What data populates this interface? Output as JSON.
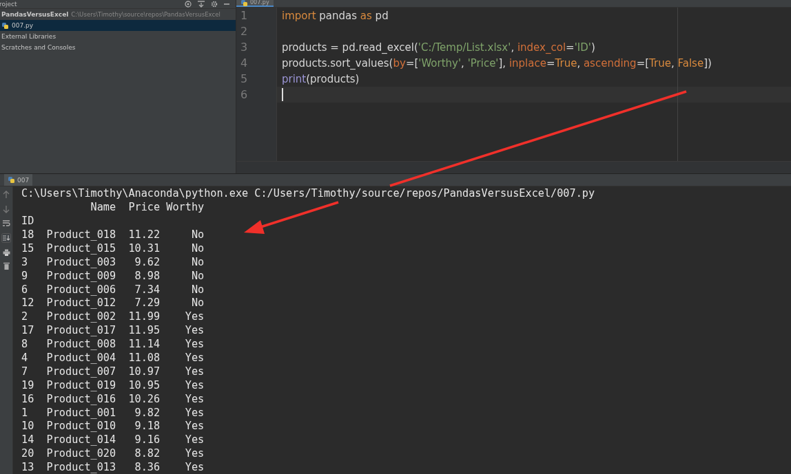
{
  "project_panel": {
    "title": "roject",
    "tree": [
      {
        "label": "PandasVersusExcel",
        "path": "C:\\Users\\Timothy\\source\\repos\\PandasVersusExcel",
        "kind": "folder",
        "selected": false,
        "children": [
          {
            "label": "007.py",
            "kind": "pyfile",
            "selected": true
          }
        ]
      },
      {
        "label": "External Libraries",
        "kind": "plain",
        "selected": false
      },
      {
        "label": "Scratches and Consoles",
        "kind": "plain",
        "selected": false
      }
    ]
  },
  "editor": {
    "tabs": [
      {
        "label": "007.py",
        "selected": true
      }
    ],
    "lines": [
      {
        "number": "1",
        "current": false,
        "tokens": [
          {
            "kind": "keyword",
            "text": "import"
          },
          {
            "kind": "plain",
            "text": " pandas "
          },
          {
            "kind": "keyword",
            "text": "as"
          },
          {
            "kind": "plain",
            "text": " pd"
          }
        ]
      },
      {
        "number": "2",
        "current": false
      },
      {
        "number": "3",
        "current": false,
        "tokens": [
          {
            "kind": "plain",
            "text": "products = pd.read_excel("
          },
          {
            "kind": "string",
            "text": "'C:/Temp/List.xlsx'"
          },
          {
            "kind": "plain",
            "text": ", "
          },
          {
            "kind": "param",
            "text": "index_col"
          },
          {
            "kind": "plain",
            "text": "="
          },
          {
            "kind": "string",
            "text": "'ID'"
          },
          {
            "kind": "plain",
            "text": ")"
          }
        ]
      },
      {
        "number": "4",
        "current": false,
        "tokens": [
          {
            "kind": "plain",
            "text": "products.sort_values("
          },
          {
            "kind": "param",
            "text": "by"
          },
          {
            "kind": "plain",
            "text": "=["
          },
          {
            "kind": "string",
            "text": "'Worthy'"
          },
          {
            "kind": "plain",
            "text": ", "
          },
          {
            "kind": "string",
            "text": "'Price'"
          },
          {
            "kind": "plain",
            "text": "], "
          },
          {
            "kind": "param",
            "text": "inplace"
          },
          {
            "kind": "plain",
            "text": "="
          },
          {
            "kind": "keyword",
            "text": "True"
          },
          {
            "kind": "plain",
            "text": ", "
          },
          {
            "kind": "param",
            "text": "ascending"
          },
          {
            "kind": "plain",
            "text": "=["
          },
          {
            "kind": "keyword",
            "text": "True"
          },
          {
            "kind": "plain",
            "text": ", "
          },
          {
            "kind": "keyword",
            "text": "False"
          },
          {
            "kind": "plain",
            "text": "])"
          }
        ]
      },
      {
        "number": "5",
        "current": false,
        "tokens": [
          {
            "kind": "builtin",
            "text": "print"
          },
          {
            "kind": "plain",
            "text": "(products)"
          }
        ]
      },
      {
        "number": "6",
        "current": true
      }
    ]
  },
  "run_panel": {
    "tabs": [
      {
        "label": "007",
        "selected": true
      }
    ],
    "output": [
      "C:\\Users\\Timothy\\Anaconda\\python.exe C:/Users/Timothy/source/repos/PandasVersusExcel/007.py",
      "           Name  Price Worthy",
      "ID",
      "18  Product_018  11.22     No",
      "15  Product_015  10.31     No",
      "3   Product_003   9.62     No",
      "9   Product_009   8.98     No",
      "6   Product_006   7.34     No",
      "12  Product_012   7.29     No",
      "2   Product_002  11.99    Yes",
      "17  Product_017  11.95    Yes",
      "8   Product_008  11.14    Yes",
      "4   Product_004  11.08    Yes",
      "7   Product_007  10.97    Yes",
      "19  Product_019  10.95    Yes",
      "16  Product_016  10.26    Yes",
      "1   Product_001   9.82    Yes",
      "10  Product_010   9.18    Yes",
      "14  Product_014   9.16    Yes",
      "20  Product_020   8.82    Yes",
      "13  Product_013   8.36    Yes"
    ]
  }
}
